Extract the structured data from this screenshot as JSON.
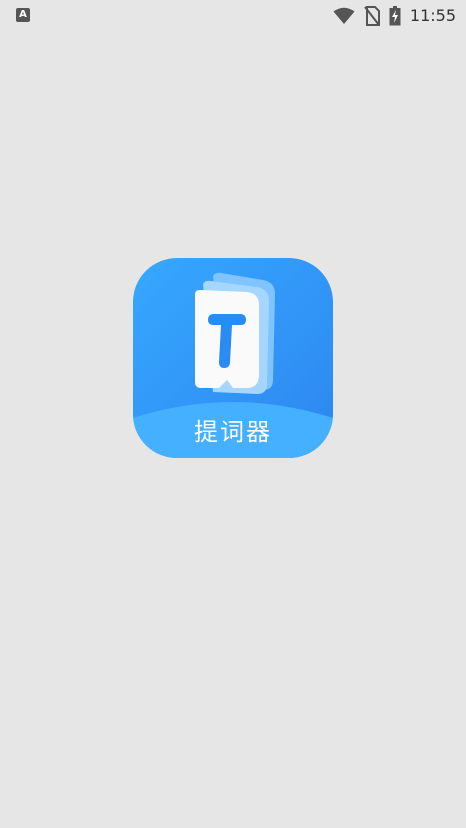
{
  "status_bar": {
    "notification_icon": "a-accessibility-icon",
    "time": "11:55",
    "icons": [
      "wifi-icon",
      "no-sim-icon",
      "battery-charging-icon"
    ]
  },
  "splash": {
    "app_name": "提词器",
    "icon_letter": "T",
    "colors": {
      "background": "#e6e6e6",
      "icon_gradient_start": "#36a8ff",
      "icon_gradient_end": "#2d86f0",
      "wave": "#44b0ff",
      "card": "#fafafa",
      "letter": "#2a8bf2"
    }
  }
}
